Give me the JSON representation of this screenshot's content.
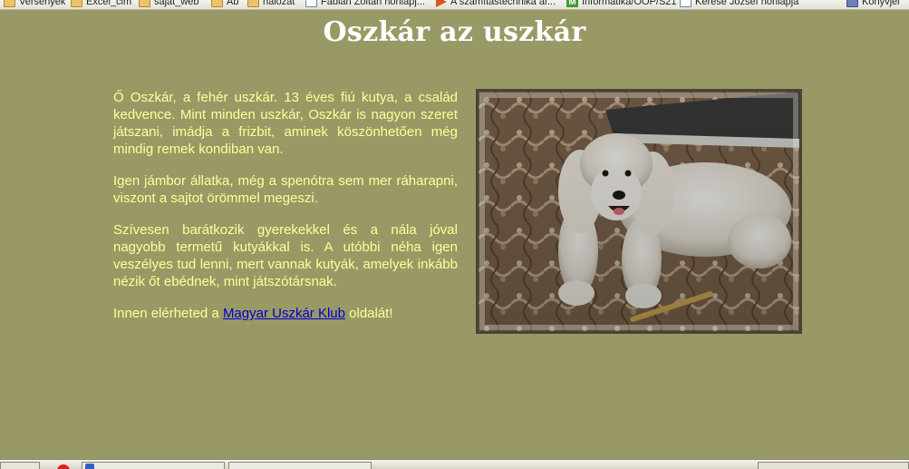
{
  "bookmarks": [
    {
      "label": "Versenyek",
      "icon": "folder-icon"
    },
    {
      "label": "Excel_cim",
      "icon": "folder-icon"
    },
    {
      "label": "sajat_web",
      "icon": "folder-icon"
    },
    {
      "label": "Ab",
      "icon": "folder-icon"
    },
    {
      "label": "halozat",
      "icon": "folder-icon"
    },
    {
      "label": "Fábián Zoltán honlapj...",
      "icon": "page-icon"
    },
    {
      "label": "A számítástechnika ár...",
      "icon": "arrow-icon"
    },
    {
      "label": "Informatika/OOP/S21",
      "icon": "m-icon"
    },
    {
      "label": "Kerese József honlapja",
      "icon": "page-icon"
    },
    {
      "label": "Könyvjel",
      "icon": "books-icon"
    }
  ],
  "page": {
    "title": "Oszkár az uszkár",
    "paragraphs": [
      "Ő Oszkár, a fehér uszkár. 13 éves fiú kutya, a család kedvence. Mint minden uszkár, Oszkár is nagyon szeret játszani, imádja a frizbit, aminek köszönhetően még mindig remek kondiban van.",
      "Igen jámbor állatka, még a spenótra sem mer ráharapni, viszont a sajtot örömmel megeszi.",
      "Szívesen barátkozik gyerekekkel és a nála jóval nagyobb termetű kutyákkal is. A utóbbi néha igen veszélyes tud lenni, mert vannak kutyák, amelyek inkább nézik őt ebédnek, mint játszótársnak."
    ],
    "link_line": {
      "before": "Innen elérheted a ",
      "link_text": "Magyar Uszkár Klub",
      "after": " oldalát!"
    }
  },
  "colors": {
    "background": "#999966",
    "title": "#ffffff",
    "text": "#ffff99",
    "link": "#0000cc"
  }
}
